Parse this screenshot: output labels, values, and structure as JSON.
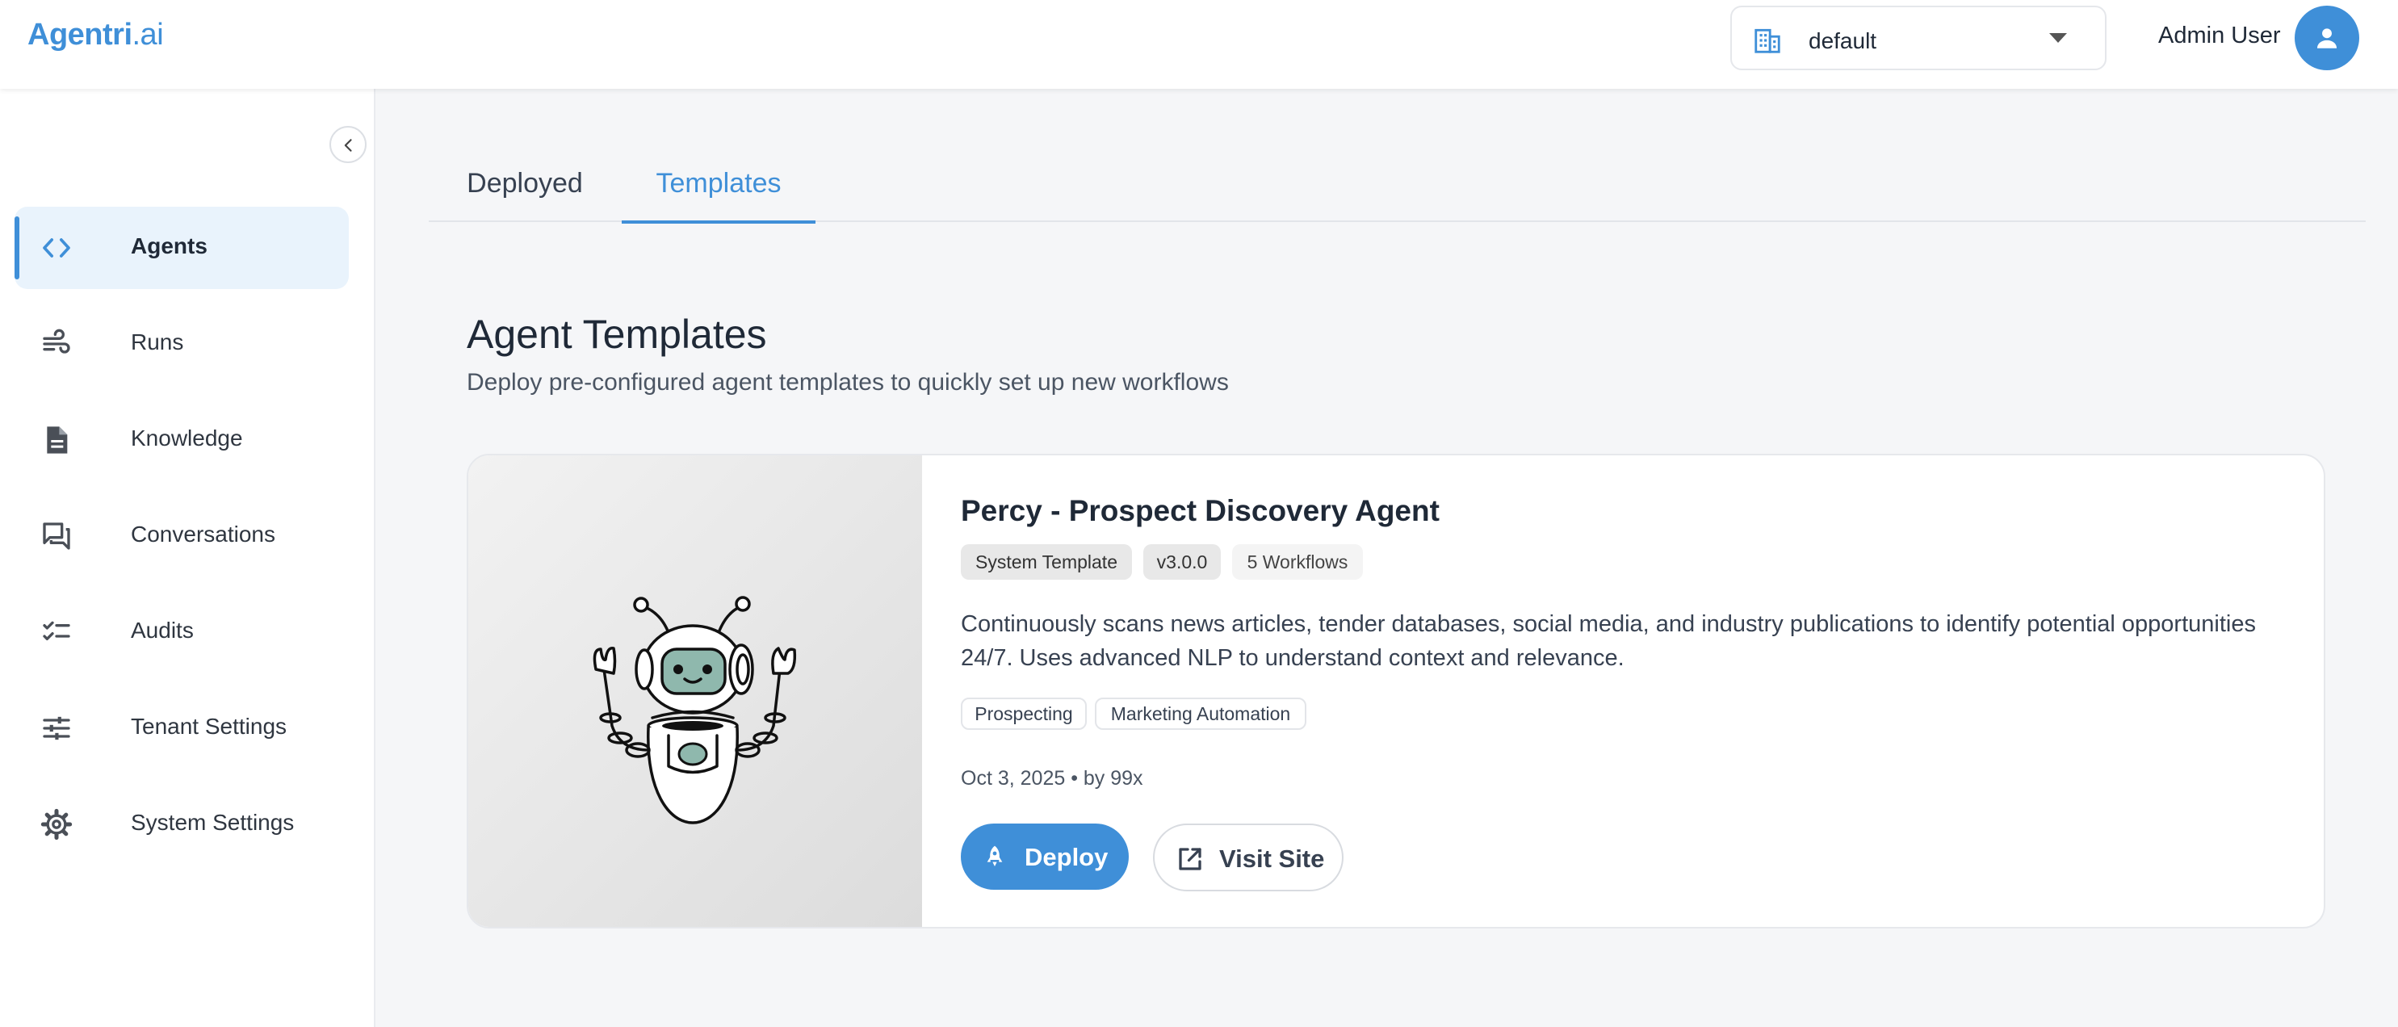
{
  "header": {
    "logo_main": "Agentri",
    "logo_suffix": ".ai",
    "tenant": {
      "value": "default",
      "icon": "building-icon"
    },
    "user_name": "Admin User",
    "avatar_icon": "person-icon"
  },
  "sidebar": {
    "collapse_icon": "chevron-left-icon",
    "items": [
      {
        "label": "Agents",
        "icon": "code-icon",
        "active": true
      },
      {
        "label": "Runs",
        "icon": "wind-icon",
        "active": false
      },
      {
        "label": "Knowledge",
        "icon": "document-icon",
        "active": false
      },
      {
        "label": "Conversations",
        "icon": "forum-icon",
        "active": false
      },
      {
        "label": "Audits",
        "icon": "checklist-icon",
        "active": false
      },
      {
        "label": "Tenant Settings",
        "icon": "sliders-icon",
        "active": false
      },
      {
        "label": "System Settings",
        "icon": "gear-icon",
        "active": false
      }
    ]
  },
  "tabs": [
    {
      "label": "Deployed",
      "active": false
    },
    {
      "label": "Templates",
      "active": true
    }
  ],
  "main": {
    "title": "Agent Templates",
    "subtitle": "Deploy pre-configured agent templates to quickly set up new workflows"
  },
  "card": {
    "title": "Percy - Prospect Discovery Agent",
    "badges": [
      "System Template",
      "v3.0.0",
      "5 Workflows"
    ],
    "description": "Continuously scans news articles, tender databases, social media, and industry publications to identify potential opportunities 24/7. Uses advanced NLP to understand context and relevance.",
    "tags": [
      "Prospecting",
      "Marketing Automation"
    ],
    "meta": "Oct 3, 2025 • by 99x",
    "deploy_label": "Deploy",
    "visit_label": "Visit Site",
    "image_icon": "robot-icon"
  },
  "colors": {
    "accent": "#3f8fd8",
    "active_bg": "#e9f3fc",
    "page_bg": "#f5f6f8"
  }
}
